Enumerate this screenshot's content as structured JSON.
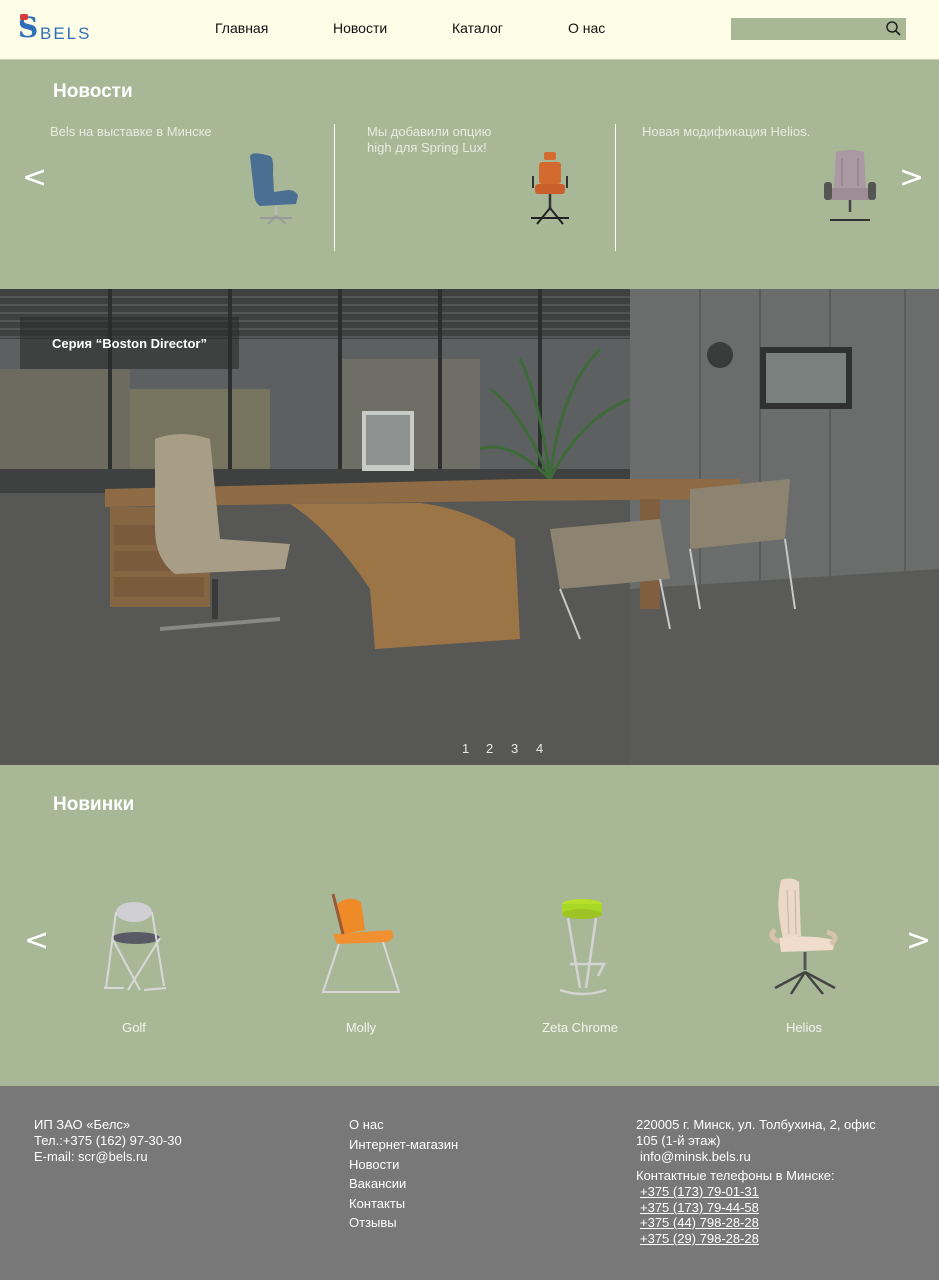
{
  "header": {
    "logo_text": "BELS",
    "logo_letter": "S",
    "nav": [
      "Главная",
      "Новости",
      "Каталог",
      "О нас"
    ],
    "search_placeholder": ""
  },
  "news": {
    "title": "Новости",
    "prev": "<",
    "next": ">",
    "items": [
      {
        "text": "Bels на выставке в Минске"
      },
      {
        "text": "Мы добавили опцию high для Spring Lux!"
      },
      {
        "text": "Новая модификация Helios."
      }
    ]
  },
  "hero": {
    "badge": "Серия “Boston Director”",
    "pages": [
      "1",
      "2",
      "3",
      "4"
    ]
  },
  "new_products": {
    "title": "Новинки",
    "prev": "<",
    "next": ">",
    "items": [
      {
        "name": "Golf"
      },
      {
        "name": "Molly"
      },
      {
        "name": "Zeta Chrome"
      },
      {
        "name": "Helios"
      }
    ]
  },
  "footer": {
    "company": "ИП ЗАО «Белс»",
    "phone": "Тел.:+375 (162) 97-30-30",
    "email": "E-mail: scr@bels.ru",
    "links": [
      "О нас",
      "Интернет-магазин",
      "Новости",
      "Вакансии",
      "Контакты",
      "Отзывы"
    ],
    "address_line1": "220005 г. Минск, ул. Толбухина, 2, офис",
    "address_line2": "105 (1-й этаж)",
    "minsk_email": "info@minsk.bels.ru",
    "phones_label": "Контактные телефоны в Минске:",
    "phones": [
      "+375 (173) 79-01-31",
      "+375 (173) 79-44-58",
      "+375 (44) 798-28-28",
      "+375 (29) 798-28-28"
    ]
  },
  "colors": {
    "header_bg": "#fdfde8",
    "section_bg": "#a8b897",
    "footer_bg": "#787878",
    "logo_blue": "#2f6fb5"
  }
}
